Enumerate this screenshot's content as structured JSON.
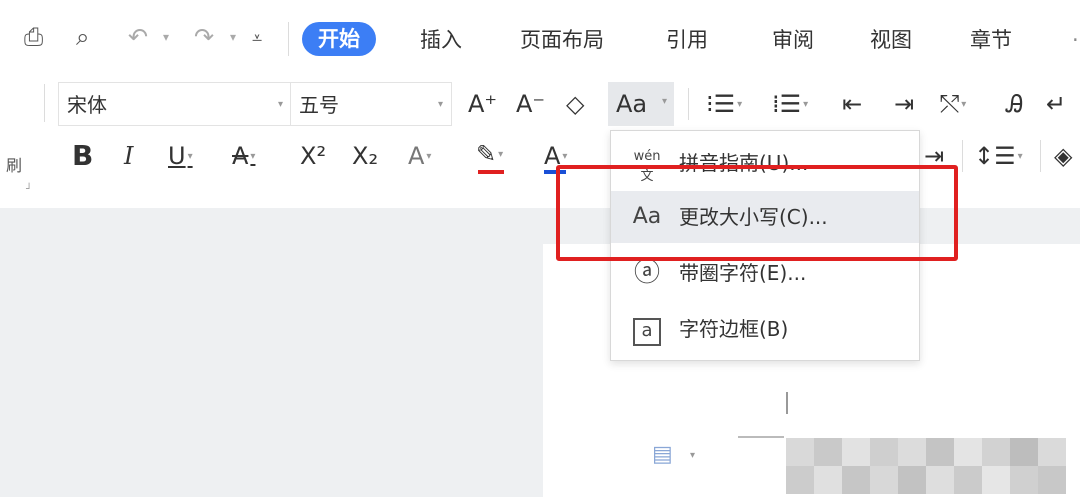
{
  "tabs": [
    {
      "label": "开始",
      "active": true
    },
    {
      "label": "插入"
    },
    {
      "label": "页面布局"
    },
    {
      "label": "引用"
    },
    {
      "label": "审阅"
    },
    {
      "label": "视图"
    },
    {
      "label": "章节"
    }
  ],
  "quick_access": {
    "print_icon": "print-icon",
    "preview_icon": "print-preview-icon",
    "undo_icon": "undo-icon",
    "redo_icon": "redo-icon",
    "customize_icon": "customize-icon"
  },
  "font": {
    "family": "宋体",
    "size": "五号"
  },
  "ribbon": {
    "grow_font": "A⁺",
    "shrink_font": "A⁻",
    "clear_format": "◇",
    "change_case": "Aa",
    "bold": "B",
    "italic": "I",
    "underline": "U",
    "strikethrough": "A",
    "superscript": "X²",
    "subscript": "X₂",
    "text_effect": "A",
    "font_color": "A",
    "side_label": "刷"
  },
  "menu": {
    "items": [
      {
        "icon": "wén",
        "label": "拼音指南(U)..."
      },
      {
        "icon": "Aa",
        "label": "更改大小写(C)..."
      },
      {
        "icon": "ⓐ",
        "label": "带圈字符(E)..."
      },
      {
        "icon": "a",
        "label": "字符边框(B)"
      }
    ]
  },
  "colors": {
    "accent": "#3c7ef5",
    "highlight_box": "#e02020",
    "font_color_underline": "#e02020",
    "text_color_underline": "#1a4fd6"
  }
}
